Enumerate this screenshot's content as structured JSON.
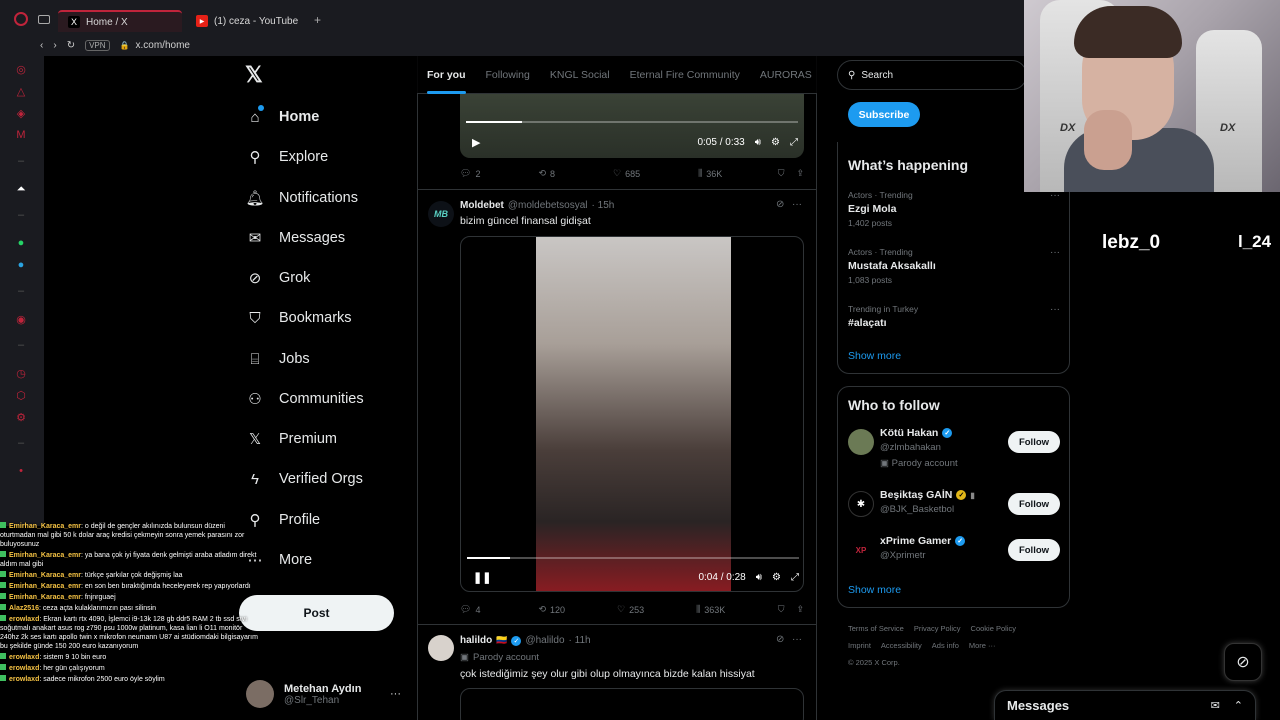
{
  "browser": {
    "tabs": [
      {
        "title": "Home / X",
        "favicon": "X"
      },
      {
        "title": "(1) ceza - YouTube",
        "favicon": "▶"
      }
    ],
    "vpn_label": "VPN",
    "url": "x.com/home"
  },
  "nav": {
    "items": [
      {
        "label": "Home",
        "icon": "home-icon"
      },
      {
        "label": "Explore",
        "icon": "search-icon"
      },
      {
        "label": "Notifications",
        "icon": "bell-icon"
      },
      {
        "label": "Messages",
        "icon": "envelope-icon"
      },
      {
        "label": "Grok",
        "icon": "grok-icon"
      },
      {
        "label": "Bookmarks",
        "icon": "bookmark-icon"
      },
      {
        "label": "Jobs",
        "icon": "briefcase-icon"
      },
      {
        "label": "Communities",
        "icon": "people-icon"
      },
      {
        "label": "Premium",
        "icon": "x-icon"
      },
      {
        "label": "Verified Orgs",
        "icon": "lightning-icon"
      },
      {
        "label": "Profile",
        "icon": "person-icon"
      },
      {
        "label": "More",
        "icon": "more-circle-icon"
      }
    ],
    "post_label": "Post",
    "profile": {
      "name": "Metehan Aydın",
      "handle": "@Slr_Tehan",
      "menu": "···"
    }
  },
  "feed": {
    "tabs": [
      "For you",
      "Following",
      "KNGL Social",
      "Eternal Fire Community",
      "AURORAS"
    ],
    "tweet0": {
      "time": "0:05 / 0:33",
      "progress": 0.17,
      "replies": "2",
      "reposts": "8",
      "likes": "685",
      "views": "36K"
    },
    "tweet1": {
      "avatar_text": "MB",
      "name": "Moldebet",
      "handle": "@moldebetsosyal",
      "time": "· 15h",
      "text": "bizim güncel finansal gidişat",
      "video_time": "0:04 / 0:28",
      "progress": 0.13,
      "replies": "4",
      "reposts": "120",
      "likes": "253",
      "views": "363K"
    },
    "tweet2": {
      "name": "halildo",
      "flag": "🇨🇴",
      "handle": "@halildo",
      "time": "· 11h",
      "sub": "Parody account",
      "text": "çok istediğimiz şey olur gibi olup olmayınca bizde kalan hissiyat"
    }
  },
  "right": {
    "search_placeholder": "Search",
    "subscribe": "Subscribe",
    "happening_title": "What’s happening",
    "trends": [
      {
        "category": "Actors · Trending",
        "name": "Ezgi Mola",
        "count": "1,402 posts"
      },
      {
        "category": "Actors · Trending",
        "name": "Mustafa Aksakallı",
        "count": "1,083 posts"
      },
      {
        "category": "Trending in Turkey",
        "name": "#alaçatı",
        "count": ""
      }
    ],
    "show_more": "Show more",
    "who_title": "Who to follow",
    "who": [
      {
        "name": "Kötü Hakan",
        "handle": "@zlmbahakan",
        "sub": "Parody account",
        "follow": "Follow",
        "badge": "blue"
      },
      {
        "name": "Beşiktaş GAİN",
        "handle": "@BJK_Basketbol",
        "sub": "",
        "follow": "Follow",
        "badge": "gold"
      },
      {
        "name": "xPrime Gamer",
        "handle": "@Xprimetr",
        "sub": "",
        "follow": "Follow",
        "badge": "blue"
      }
    ],
    "show_more2": "Show more",
    "footer": [
      "Terms of Service",
      "Privacy Policy",
      "Cookie Policy",
      "Imprint",
      "Accessibility",
      "Ads info",
      "More ···",
      "© 2025 X Corp."
    ],
    "messages": "Messages"
  },
  "chat": [
    {
      "user": "Emirhan_Karaca_emr",
      "msg": ": o değil de gençler akılınızda bulunsun düzeni oturtmadan mal gibi 50 k dolar araç kredisi çekmeyin sonra yemek parasını zor buluyosunuz"
    },
    {
      "user": "Emirhan_Karaca_emr",
      "msg": ": ya bana çok iyi fiyata denk gelmişti araba atladım direkt aldım mal gibi"
    },
    {
      "user": "Emirhan_Karaca_emr",
      "msg": ": türkçe şarkılar çok değişmiş laa"
    },
    {
      "user": "Emirhan_Karaca_emr",
      "msg": ": en son ben bıraktığımda heceleyerek rep yapıyorlardı"
    },
    {
      "user": "Emirhan_Karaca_emr",
      "msg": ": fnjnrguaej"
    },
    {
      "user": "Alaz2516",
      "msg": ": ceza açta kulaklarımızın pası silinsin"
    },
    {
      "user": "erowlaxd",
      "msg": ": Ekran kartı rtx 4090, İşlemci i9-13k 128 gb ddr5 RAM 2 tb ssd sıvı soğutmalı anakart asus rog z790 psu 1000w platinum, kasa lian li O11 monitör 240hz 2k ses kartı apollo twin x mikrofon neumann U87 ai stüdiomdaki bilgisayarım bu şekilde günde 150 200 euro kazanıyorum"
    },
    {
      "user": "erowlaxd",
      "msg": ": sistem 9 10 bin euro"
    },
    {
      "user": "erowlaxd",
      "msg": ": her gün çalışıyorum"
    },
    {
      "user": "erowlaxd",
      "msg": ": sadece mikrofon 2500 euro öyle söylim"
    }
  ],
  "overlay": {
    "name": "lebz_0",
    "name2": "l_24"
  },
  "colors": {
    "accent": "#1d9bf0",
    "opera_red": "#c0243b",
    "chat_user": "#f6c344"
  }
}
